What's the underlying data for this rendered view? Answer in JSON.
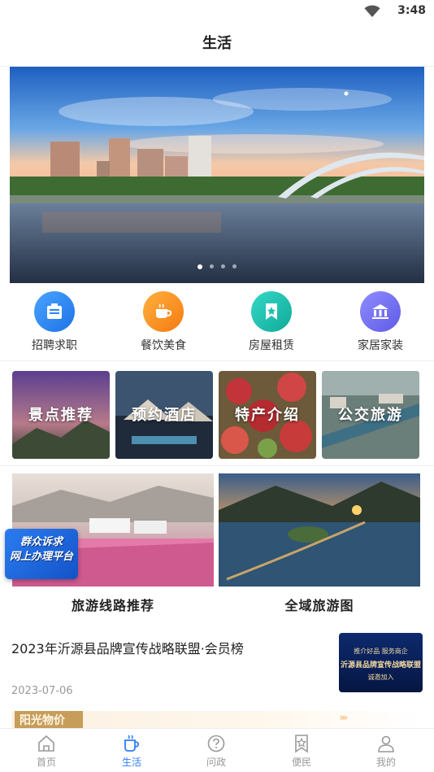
{
  "status_bar": {
    "time": "3:48",
    "icons": [
      "wifi-icon"
    ]
  },
  "header": {
    "title": "生活"
  },
  "banner": {
    "slide_count": 4,
    "active_index": 0
  },
  "services": [
    {
      "label": "招聘求职",
      "icon": "briefcase-icon",
      "color": "#2a85f5"
    },
    {
      "label": "餐饮美食",
      "icon": "coffee-cup-icon",
      "color": "#f7901e"
    },
    {
      "label": "房屋租赁",
      "icon": "star-bookmark-icon",
      "color": "#18bfae"
    },
    {
      "label": "家居家装",
      "icon": "bank-building-icon",
      "color": "#6c69f0"
    }
  ],
  "tiles": [
    {
      "label": "景点推荐"
    },
    {
      "label": "预约酒店"
    },
    {
      "label": "特产介绍"
    },
    {
      "label": "公交旅游"
    }
  ],
  "cards": [
    {
      "title": "旅游线路推荐"
    },
    {
      "title": "全域旅游图"
    }
  ],
  "float_badge": {
    "line1": "群众诉求",
    "line2": "网上办理平台"
  },
  "news": {
    "title": "2023年沂源县品牌宣传战略联盟·会员榜",
    "date": "2023-07-06",
    "thumb_line1": "推介好品 服务商企",
    "thumb_line2": "沂源县品牌宣传战略联盟",
    "thumb_line3": "诚邀加入"
  },
  "strip": {
    "tag": "阳光物价",
    "arrows": "›››"
  },
  "tabbar": {
    "active_color": "#2f7cf6",
    "items": [
      {
        "label": "首页",
        "icon": "home-icon"
      },
      {
        "label": "生活",
        "icon": "cup-icon"
      },
      {
        "label": "问政",
        "icon": "question-circle-icon"
      },
      {
        "label": "便民",
        "icon": "star-bookmark-icon"
      },
      {
        "label": "我的",
        "icon": "user-icon"
      }
    ]
  }
}
